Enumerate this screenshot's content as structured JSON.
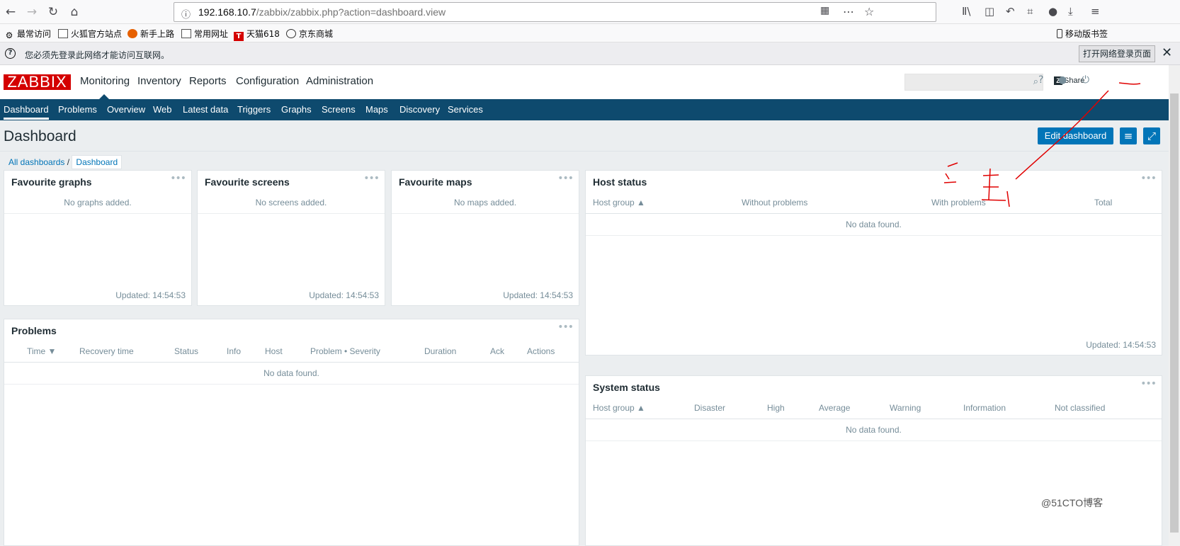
{
  "browser": {
    "url_host": "192.168.10.7",
    "url_path": "/zabbix/zabbix.php?action=dashboard.view",
    "bookmarks": [
      "最常访问",
      "火狐官方站点",
      "新手上路",
      "常用网址",
      "天猫618",
      "京东商城"
    ],
    "mobile_bookmarks": "移动版书签",
    "notification": "您必须先登录此网络才能访问互联网。",
    "notification_button": "打开网络登录页面"
  },
  "zabbix": {
    "logo": "ZABBIX",
    "top_menu": [
      "Monitoring",
      "Inventory",
      "Reports",
      "Configuration",
      "Administration"
    ],
    "share": "Share",
    "sub_menu": [
      "Dashboard",
      "Problems",
      "Overview",
      "Web",
      "Latest data",
      "Triggers",
      "Graphs",
      "Screens",
      "Maps",
      "Discovery",
      "Services"
    ],
    "page_title": "Dashboard",
    "edit_button": "Edit dashboard",
    "breadcrumb": [
      "All dashboards",
      "Dashboard"
    ],
    "widgets": {
      "fav_graphs": {
        "title": "Favourite graphs",
        "empty": "No graphs added.",
        "updated": "Updated: 14:54:53"
      },
      "fav_screens": {
        "title": "Favourite screens",
        "empty": "No screens added.",
        "updated": "Updated: 14:54:53"
      },
      "fav_maps": {
        "title": "Favourite maps",
        "empty": "No maps added.",
        "updated": "Updated: 14:54:53"
      },
      "host_status": {
        "title": "Host status",
        "columns": [
          "Host group ▲",
          "Without problems",
          "With problems",
          "Total"
        ],
        "empty": "No data found.",
        "updated": "Updated: 14:54:53"
      },
      "problems": {
        "title": "Problems",
        "columns": [
          "Time ▼",
          "Recovery time",
          "Status",
          "Info",
          "Host",
          "Problem • Severity",
          "Duration",
          "Ack",
          "Actions"
        ],
        "empty": "No data found."
      },
      "system_status": {
        "title": "System status",
        "columns": [
          "Host group ▲",
          "Disaster",
          "High",
          "Average",
          "Warning",
          "Information",
          "Not classified"
        ],
        "empty": "No data found."
      }
    }
  },
  "watermark": "@51CTO博客",
  "colors": {
    "accent": "#0275b8",
    "nav": "#0e4a6e",
    "logo": "#d40000",
    "annotation": "#e00000"
  }
}
